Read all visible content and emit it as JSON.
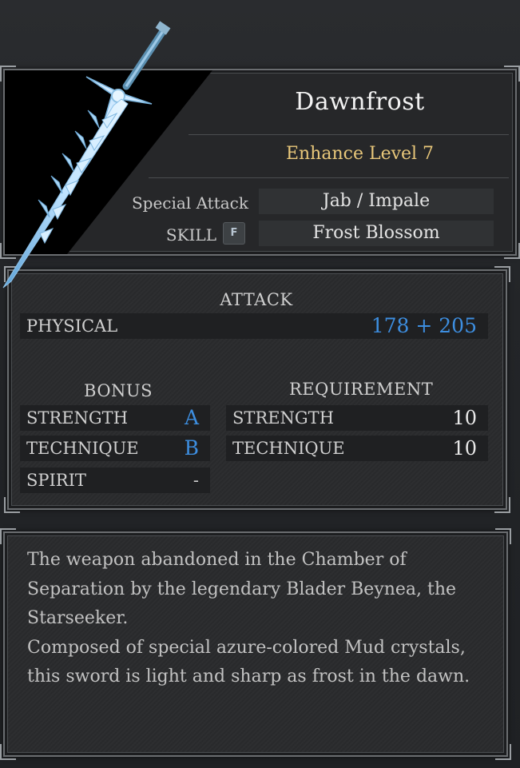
{
  "weapon": {
    "name": "Dawnfrost",
    "enhance_label": "Enhance Level 7",
    "special_attack_label": "Special Attack",
    "special_attack_value": "Jab / Impale",
    "skill_label": "SKILL",
    "skill_key": "F",
    "skill_value": "Frost Blossom"
  },
  "attack": {
    "title": "ATTACK",
    "physical_label": "PHYSICAL",
    "physical_value": "178 + 205"
  },
  "bonus": {
    "title": "BONUS",
    "rows": [
      {
        "label": "STRENGTH",
        "value": "A"
      },
      {
        "label": "TECHNIQUE",
        "value": "B"
      },
      {
        "label": "SPIRIT",
        "value": "-"
      }
    ]
  },
  "requirement": {
    "title": "REQUIREMENT",
    "rows": [
      {
        "label": "STRENGTH",
        "value": "10"
      },
      {
        "label": "TECHNIQUE",
        "value": "10"
      }
    ]
  },
  "lore": {
    "paragraph1": "The weapon abandoned in the Chamber of Separation by the legendary Blader Beynea, the Starseeker.",
    "paragraph2": "Composed of special azure-colored Mud crystals, this sword is light and sharp as frost in the dawn."
  },
  "colors": {
    "accent_blue": "#3d8ee0",
    "enhance_gold": "#e8c77a"
  },
  "icons": {
    "weapon": "ice-sword-icon"
  }
}
